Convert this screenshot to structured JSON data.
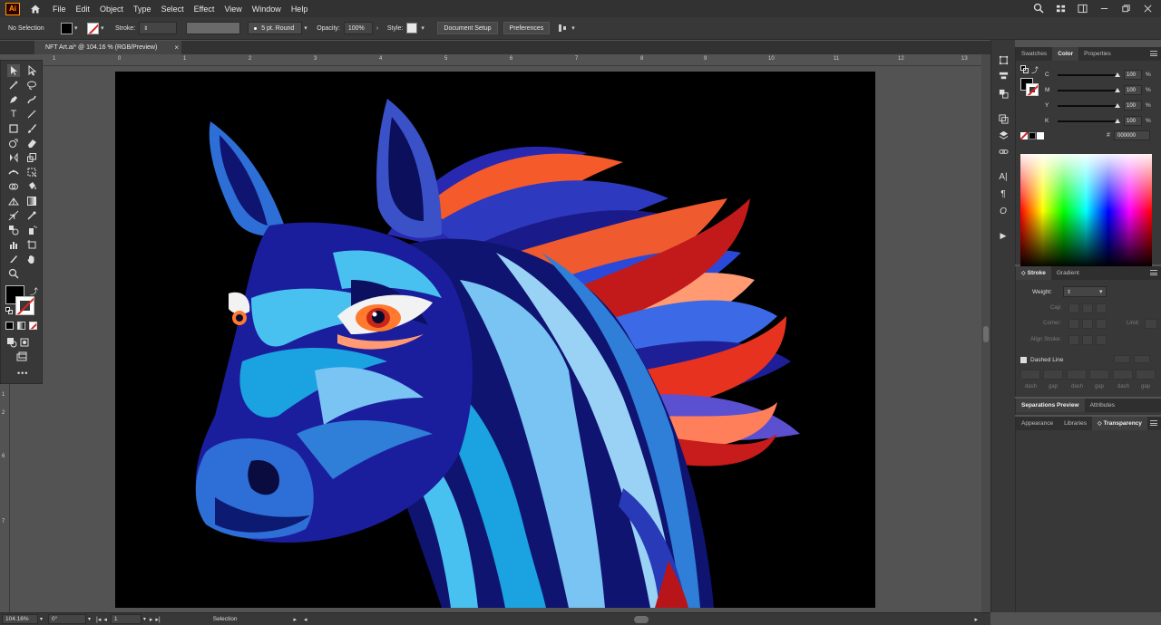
{
  "menubar": {
    "logo": "Ai",
    "items": [
      "File",
      "Edit",
      "Object",
      "Type",
      "Select",
      "Effect",
      "View",
      "Window",
      "Help"
    ]
  },
  "controlbar": {
    "selection_status": "No Selection",
    "stroke_label": "Stroke:",
    "brush": "5 pt. Round",
    "opacity_label": "Opacity:",
    "opacity_value": "100%",
    "style_label": "Style:",
    "document_setup": "Document Setup",
    "preferences": "Preferences"
  },
  "document": {
    "tab_title": "NFT Art.ai* @ 104.16 % (RGB/Preview)",
    "close": "×"
  },
  "ruler": {
    "h_ticks": [
      "1",
      "0",
      "1",
      "2",
      "3",
      "4",
      "5",
      "6",
      "7",
      "8",
      "9",
      "10",
      "11",
      "12",
      "13"
    ],
    "v_ticks": [
      "1",
      "2",
      "3",
      "4",
      "5",
      "6",
      "7"
    ]
  },
  "color_panel": {
    "tabs": [
      "Swatches",
      "Color",
      "Properties"
    ],
    "active_tab": "Color",
    "channels": [
      {
        "label": "C",
        "value": "100",
        "unit": "%"
      },
      {
        "label": "M",
        "value": "100",
        "unit": "%"
      },
      {
        "label": "Y",
        "value": "100",
        "unit": "%"
      },
      {
        "label": "K",
        "value": "100",
        "unit": "%"
      }
    ],
    "hex_symbol": "#",
    "hex_value": "000000"
  },
  "stroke_panel": {
    "tabs": [
      "Stroke",
      "Gradient"
    ],
    "weight_label": "Weight:",
    "cap_label": "Cap:",
    "corner_label": "Corner:",
    "limit_label": "Limit:",
    "align_label": "Align Stroke:",
    "dashed_line": "Dashed Line",
    "dash_labels": [
      "dash",
      "gap",
      "dash",
      "gap",
      "dash",
      "gap"
    ]
  },
  "separations_panel": {
    "tabs": [
      "Separations Preview",
      "Attributes"
    ]
  },
  "transparency_panel": {
    "tabs": [
      "Appearance",
      "Libraries",
      "Transparency"
    ]
  },
  "statusbar": {
    "zoom": "104.16%",
    "rotation": "0°",
    "artboard_number": "1",
    "tool": "Selection"
  },
  "colors": {
    "artboard_bg": "#000000",
    "pasteboard": "#535353",
    "chrome": "#383838",
    "accent_orange": "#ff9a00"
  }
}
